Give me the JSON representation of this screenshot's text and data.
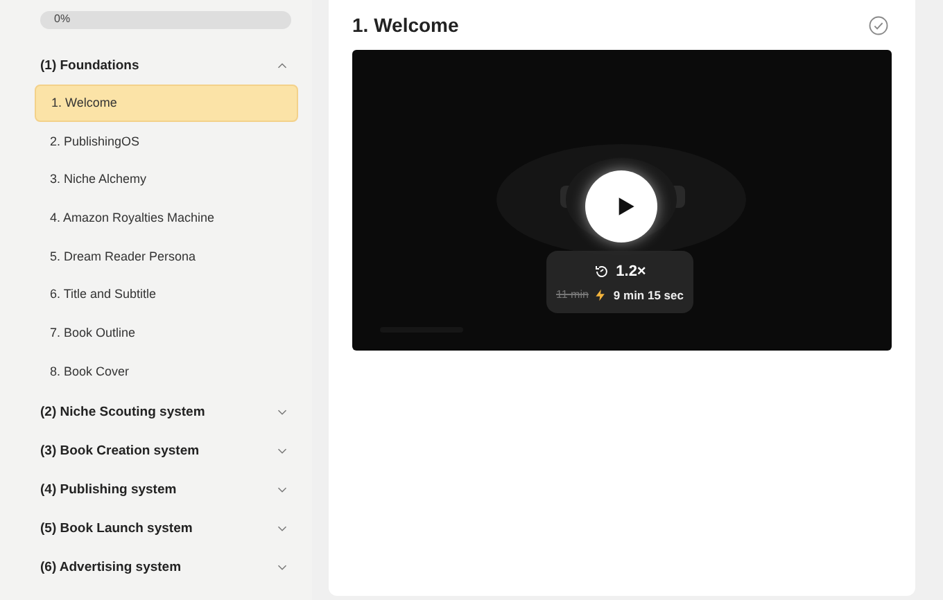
{
  "progress": {
    "level": 0,
    "label": "0%"
  },
  "sections": [
    {
      "title": "(1) Foundations",
      "expanded": true,
      "lessons": [
        {
          "title": "1. Welcome",
          "selected": true
        },
        {
          "title": "2. PublishingOS",
          "selected": false
        },
        {
          "title": "3. Niche Alchemy",
          "selected": false
        },
        {
          "title": "4. Amazon Royalties Machine",
          "selected": false
        },
        {
          "title": "5. Dream Reader Persona",
          "selected": false
        },
        {
          "title": "6. Title and Subtitle",
          "selected": false
        },
        {
          "title": "7. Book Outline",
          "selected": false
        },
        {
          "title": "8. Book Cover",
          "selected": false
        }
      ]
    },
    {
      "title": "(2) Niche Scouting system",
      "expanded": false
    },
    {
      "title": "(3) Book Creation system",
      "expanded": false
    },
    {
      "title": "(4) Publishing system",
      "expanded": false
    },
    {
      "title": "(5) Book Launch system",
      "expanded": false
    },
    {
      "title": "(6) Advertising system",
      "expanded": false
    }
  ],
  "lesson": {
    "title": "1. Welcome",
    "completed": false,
    "video": {
      "speed": "1.2×",
      "original_time": "11 min",
      "new_time": "9 min 15 sec"
    }
  }
}
